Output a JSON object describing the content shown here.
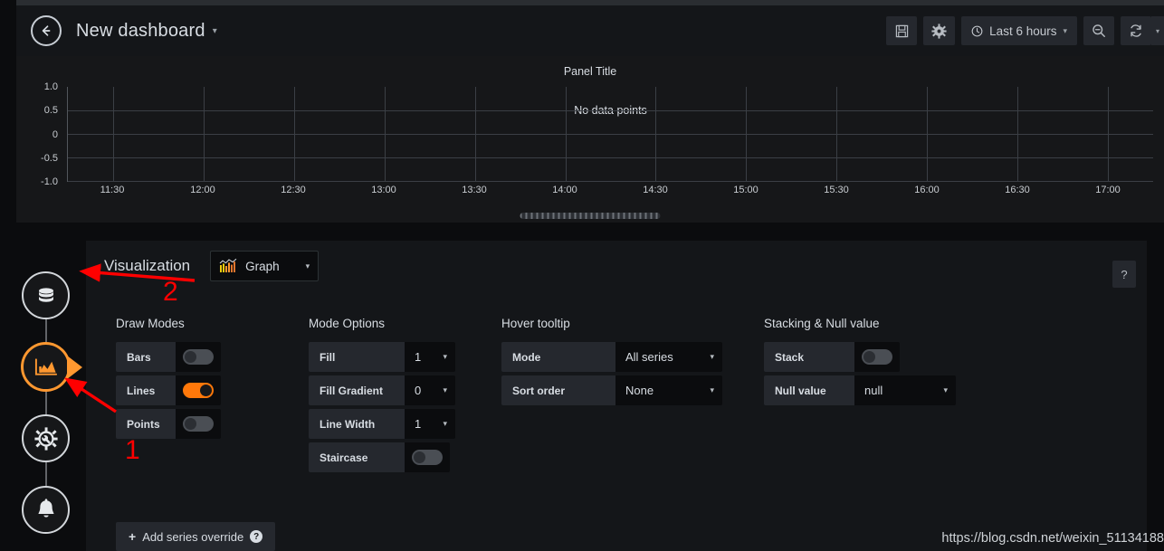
{
  "topnav": {
    "back_icon": "arrow-left-icon",
    "title": "New dashboard",
    "title_caret": "▾",
    "save_icon": "save-disk-icon",
    "settings_icon": "gear-icon",
    "time_clock_icon": "clock-icon",
    "time_range": "Last 6 hours",
    "time_caret": "▾",
    "zoom_out_icon": "zoom-out-icon",
    "refresh_icon": "refresh-icon",
    "refresh_caret": "▾"
  },
  "graph_panel": {
    "title": "Panel Title",
    "no_data_text": "No data points",
    "drag_handle": "resize-handle"
  },
  "chart_data": {
    "type": "line",
    "title": "Panel Title",
    "xlabel": "",
    "ylabel": "",
    "series": [],
    "annotation": "No data points",
    "grid": true,
    "legend_position": "none",
    "ylim": [
      -1.0,
      1.0
    ],
    "ytick_labels": [
      "1.0",
      "0.5",
      "0",
      "-0.5",
      "-1.0"
    ],
    "ytick_values": [
      1.0,
      0.5,
      0,
      -0.5,
      -1.0
    ],
    "xtick_labels": [
      "11:30",
      "12:00",
      "12:30",
      "13:00",
      "13:30",
      "14:00",
      "14:30",
      "15:00",
      "15:30",
      "16:00",
      "16:30",
      "17:00"
    ]
  },
  "edit_sidebar": {
    "items": [
      {
        "name": "queries",
        "icon": "database-icon",
        "active": false
      },
      {
        "name": "visualization",
        "icon": "graph-area-icon",
        "active": true
      },
      {
        "name": "general",
        "icon": "gear-wrench-icon",
        "active": false
      },
      {
        "name": "alert",
        "icon": "bell-icon",
        "active": false
      }
    ]
  },
  "options": {
    "visualization_label": "Visualization",
    "visualization_type": "Graph",
    "visualization_icon": "bar-chart-icon",
    "visualization_caret": "▾",
    "help_label": "?",
    "columns": [
      {
        "title": "Draw Modes",
        "rows": [
          {
            "label": "Bars",
            "control": "toggle",
            "value": "off"
          },
          {
            "label": "Lines",
            "control": "toggle",
            "value": "on"
          },
          {
            "label": "Points",
            "control": "toggle",
            "value": "off"
          }
        ]
      },
      {
        "title": "Mode Options",
        "rows": [
          {
            "label": "Fill",
            "control": "select",
            "value": "1"
          },
          {
            "label": "Fill Gradient",
            "control": "select",
            "value": "0"
          },
          {
            "label": "Line Width",
            "control": "select",
            "value": "1"
          },
          {
            "label": "Staircase",
            "control": "toggle",
            "value": "off"
          }
        ]
      },
      {
        "title": "Hover tooltip",
        "rows": [
          {
            "label": "Mode",
            "control": "select",
            "value": "All series"
          },
          {
            "label": "Sort order",
            "control": "select",
            "value": "None"
          }
        ]
      },
      {
        "title": "Stacking & Null value",
        "rows": [
          {
            "label": "Stack",
            "control": "toggle",
            "value": "off"
          },
          {
            "label": "Null value",
            "control": "select",
            "value": "null"
          }
        ]
      }
    ],
    "add_override": {
      "plus": "+",
      "label": "Add series override",
      "help": "?"
    }
  },
  "annotations": [
    {
      "id": "1",
      "label": "1"
    },
    {
      "id": "2",
      "label": "2"
    }
  ],
  "watermark": "https://blog.csdn.net/weixin_51134188",
  "colors": {
    "accent_orange": "#ff780a",
    "active_ring": "#ff9830",
    "annotation_red": "#ff0000",
    "panel_bg": "#161719",
    "pane_bg": "#141619",
    "page_bg": "#0b0c0e"
  }
}
